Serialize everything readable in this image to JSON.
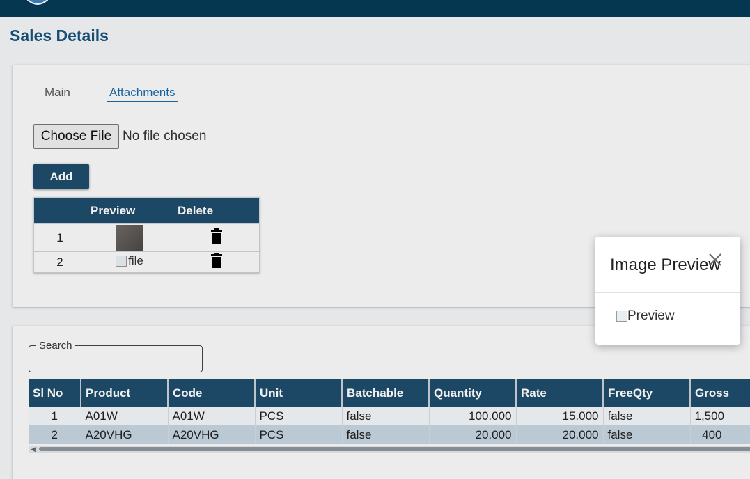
{
  "page": {
    "title": "Sales Details"
  },
  "tabs": [
    {
      "label": "Main"
    },
    {
      "label": "Attachments"
    }
  ],
  "file_input": {
    "button_label": "Choose File",
    "status": "No file chosen"
  },
  "add_button": {
    "label": "Add"
  },
  "attachments": {
    "headers": [
      "",
      "Preview",
      "Delete"
    ],
    "rows": [
      {
        "no": "1",
        "preview_alt": "",
        "delete_icon": "trash-icon"
      },
      {
        "no": "2",
        "preview_alt": "file",
        "delete_icon": "trash-icon"
      }
    ]
  },
  "search": {
    "label": "Search",
    "value": ""
  },
  "grid": {
    "headers": [
      "Sl No",
      "Product",
      "Code",
      "Unit",
      "Batchable",
      "Quantity",
      "Rate",
      "FreeQty",
      "Gross"
    ],
    "rows": [
      [
        "1",
        "A01W",
        "A01W",
        "PCS",
        "false",
        "100.000",
        "15.000",
        "false",
        "1,500"
      ],
      [
        "2",
        "A20VHG",
        "A20VHG",
        "PCS",
        "false",
        "20.000",
        "20.000",
        "false",
        "400"
      ]
    ]
  },
  "modal": {
    "title": "Image Preview",
    "image_alt": "Preview",
    "close_icon": "close-icon"
  },
  "colors": {
    "header_bg": "#073b55",
    "accent": "#1e4d6b",
    "link": "#1c6aa8"
  }
}
